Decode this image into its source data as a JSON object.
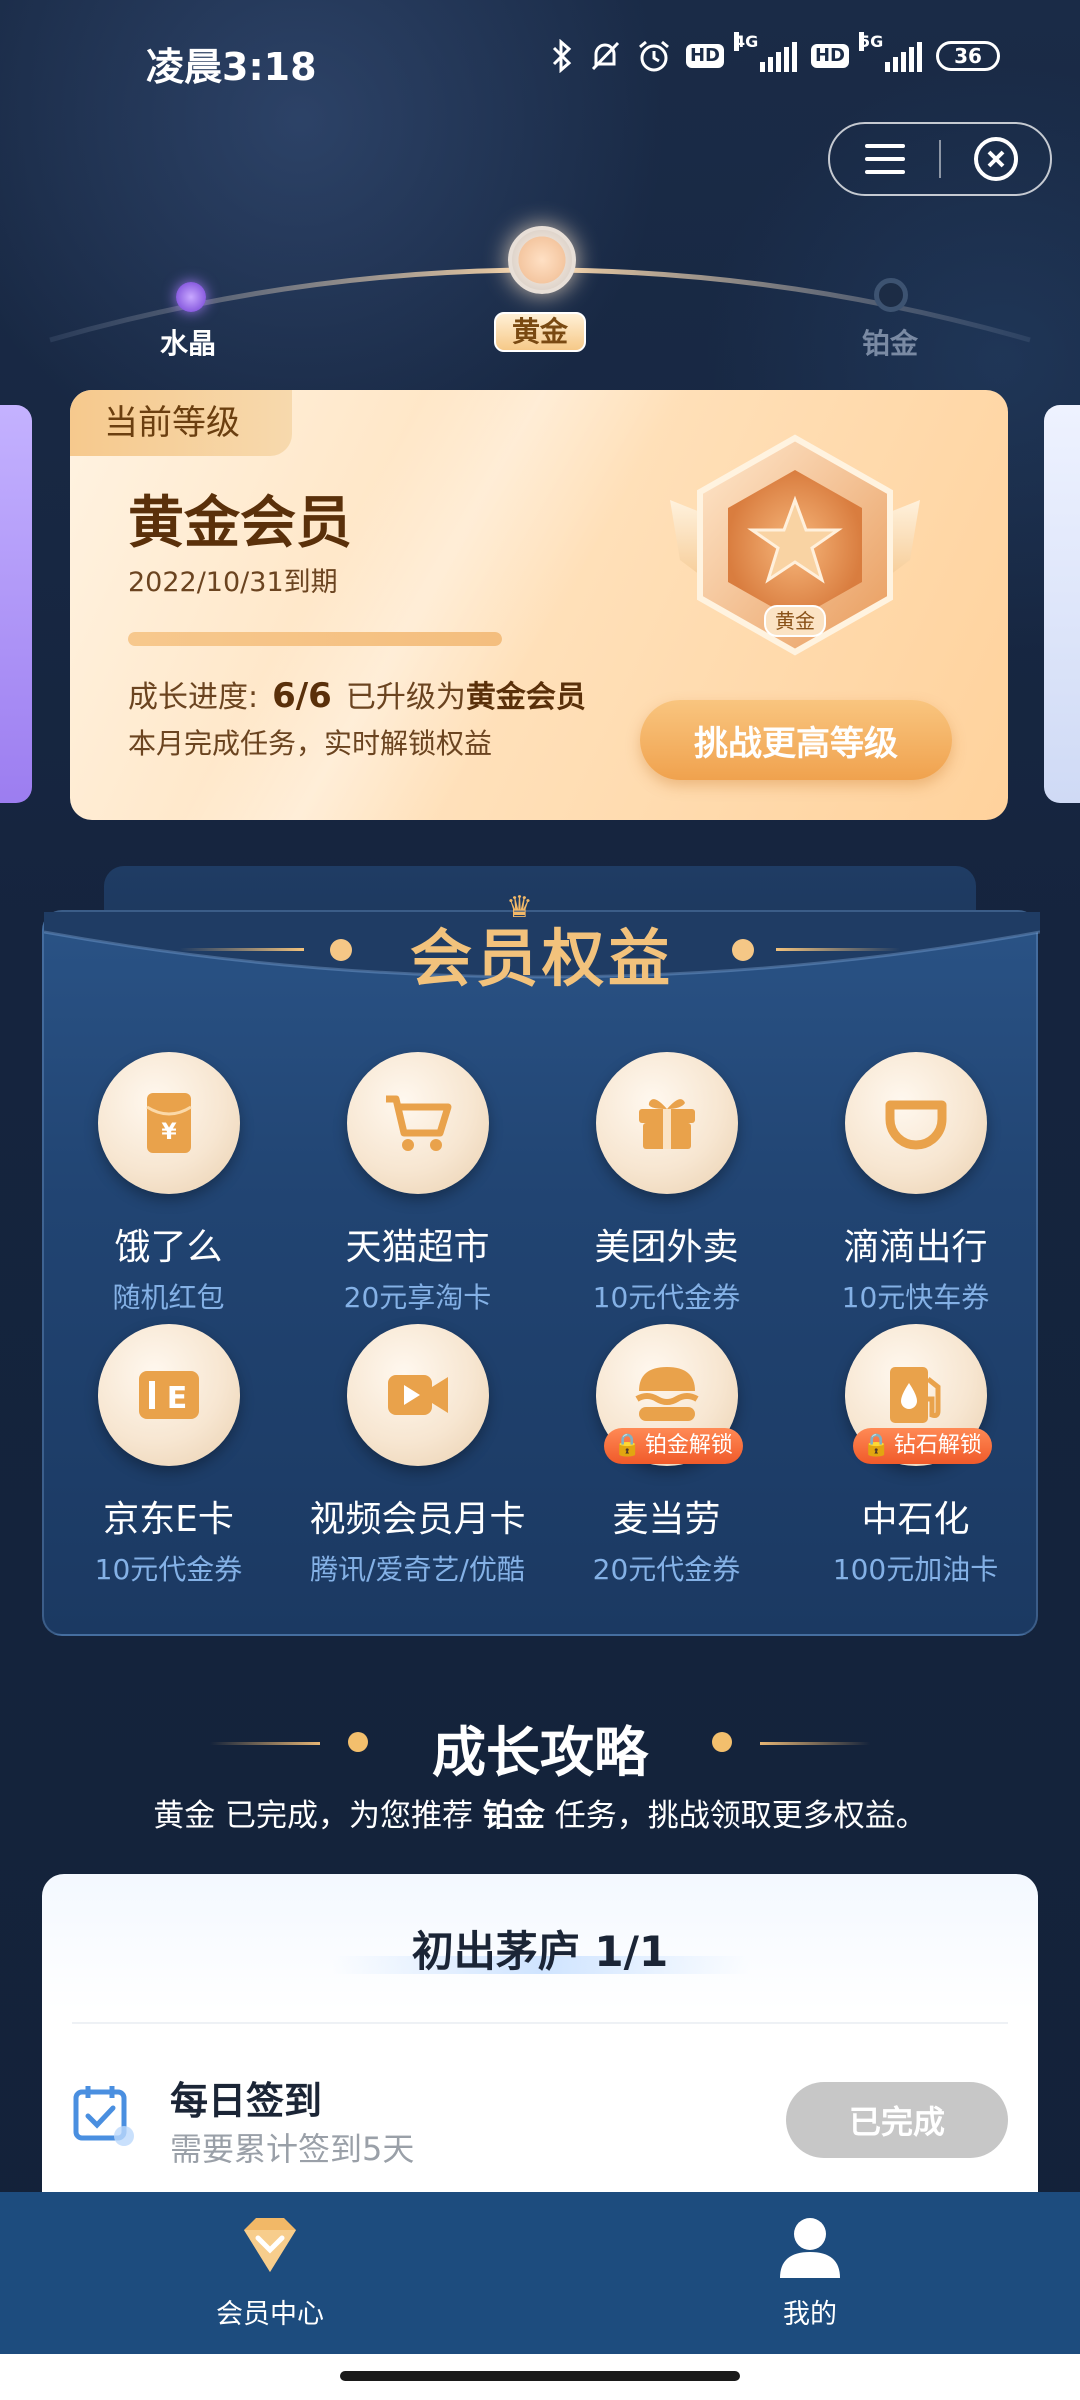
{
  "status_bar": {
    "time": "凌晨3:18",
    "hd1": "HD",
    "net1": "4G",
    "hd2": "HD",
    "net2": "5G",
    "battery": "36"
  },
  "level_track": {
    "levels": [
      {
        "label": "水晶",
        "state": "passed"
      },
      {
        "label": "黄金",
        "state": "current"
      },
      {
        "label": "铂金",
        "state": "locked"
      }
    ]
  },
  "level_card": {
    "tag": "当前等级",
    "title": "黄金会员",
    "expiry": "2022/10/31到期",
    "progress_percent": 100,
    "growth_label": "成长进度:",
    "growth_value": "6/6",
    "upgraded_prefix": "已升级为",
    "upgraded_level": "黄金会员",
    "tip": "本月完成任务，实时解锁权益",
    "badge_label": "黄金",
    "challenge_button": "挑战更高等级"
  },
  "benefits": {
    "title": "会员权益",
    "items": [
      {
        "name": "饿了么",
        "sub": "随机红包",
        "icon": "red-envelope-icon",
        "lock": ""
      },
      {
        "name": "天猫超市",
        "sub": "20元享淘卡",
        "icon": "shopping-cart-icon",
        "lock": ""
      },
      {
        "name": "美团外卖",
        "sub": "10元代金券",
        "icon": "gift-icon",
        "lock": ""
      },
      {
        "name": "滴滴出行",
        "sub": "10元快车券",
        "icon": "didi-icon",
        "lock": ""
      },
      {
        "name": "京东E卡",
        "sub": "10元代金券",
        "icon": "e-card-icon",
        "lock": ""
      },
      {
        "name": "视频会员月卡",
        "sub": "腾讯/爱奇艺/优酷",
        "icon": "video-camera-icon",
        "lock": ""
      },
      {
        "name": "麦当劳",
        "sub": "20元代金券",
        "icon": "burger-icon",
        "lock": "铂金解锁"
      },
      {
        "name": "中石化",
        "sub": "100元加油卡",
        "icon": "fuel-pump-icon",
        "lock": "钻石解锁"
      }
    ]
  },
  "growth_strategy": {
    "title": "成长攻略",
    "sub_part1": "黄金 已完成，为您推荐",
    "sub_bold": "铂金",
    "sub_part2": "任务，挑战领取更多权益。"
  },
  "task_card": {
    "stage": "初出茅庐 1/1",
    "task_name": "每日签到",
    "task_desc": "需要累计签到5天",
    "status_button": "已完成"
  },
  "bottom_nav": {
    "items": [
      {
        "label": "会员中心",
        "icon": "diamond-icon"
      },
      {
        "label": "我的",
        "icon": "user-icon"
      }
    ]
  },
  "colors": {
    "background": "#13223a",
    "gold_accent": "#f2c27c",
    "benefit_sub": "#84b1e6",
    "nav_bg": "#1d4c7e"
  }
}
